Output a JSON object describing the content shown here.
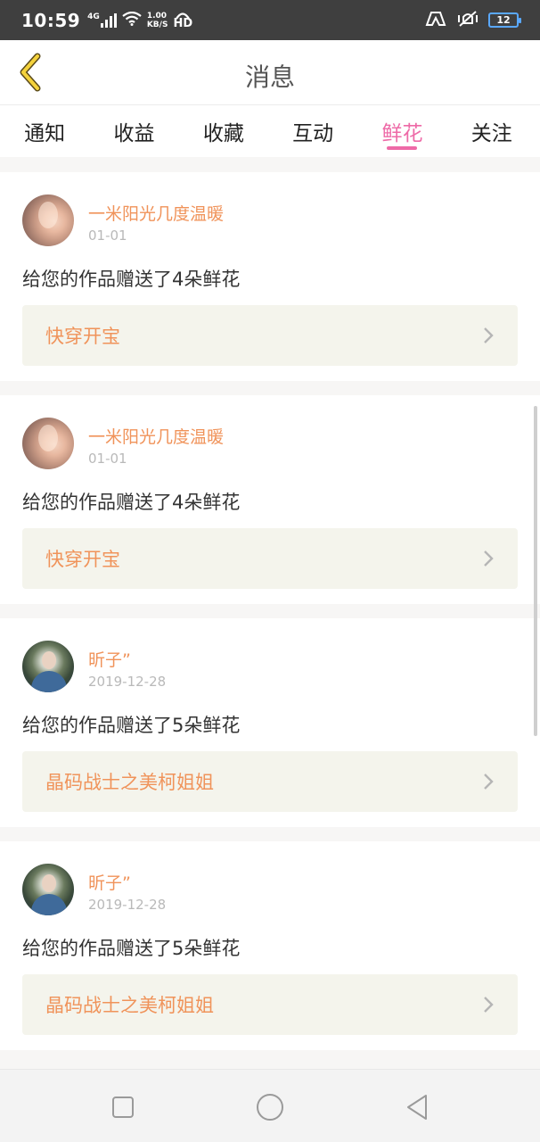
{
  "status_bar": {
    "time": "10:59",
    "network": "4G",
    "speed_value": "1.00",
    "speed_unit": "KB/S",
    "hd": "HD",
    "battery": "12"
  },
  "header": {
    "title": "消息"
  },
  "tabs": [
    {
      "label": "通知",
      "active": false
    },
    {
      "label": "收益",
      "active": false
    },
    {
      "label": "收藏",
      "active": false
    },
    {
      "label": "互动",
      "active": false
    },
    {
      "label": "鲜花",
      "active": true
    },
    {
      "label": "关注",
      "active": false
    }
  ],
  "messages": [
    {
      "username": "一米阳光几度温暖",
      "date": "01-01",
      "text": "给您的作品赠送了4朵鲜花",
      "work_title": "快穿开宝"
    },
    {
      "username": "一米阳光几度温暖",
      "date": "01-01",
      "text": "给您的作品赠送了4朵鲜花",
      "work_title": "快穿开宝"
    },
    {
      "username": "昕子”",
      "date": "2019-12-28",
      "text": "给您的作品赠送了5朵鲜花",
      "work_title": "晶码战士之美柯姐姐"
    },
    {
      "username": "昕子”",
      "date": "2019-12-28",
      "text": "给您的作品赠送了5朵鲜花",
      "work_title": "晶码战士之美柯姐姐"
    }
  ],
  "colors": {
    "accent_pink": "#ee6aa7",
    "username_orange": "#f0935a",
    "link_bg": "#f4f4ec"
  },
  "icons": {
    "back": "chevron-left-icon",
    "link_arrow": "chevron-right-icon",
    "nav_recents": "square-icon",
    "nav_home": "circle-icon",
    "nav_back": "triangle-back-icon"
  }
}
